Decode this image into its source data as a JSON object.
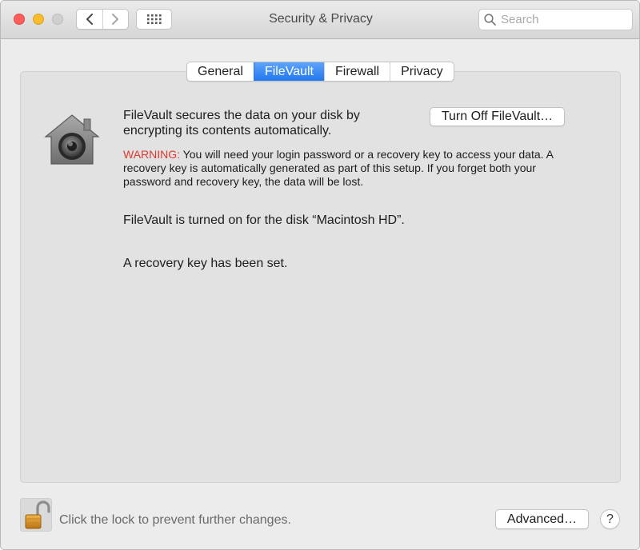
{
  "window": {
    "title": "Security & Privacy"
  },
  "toolbar": {
    "back_icon": "chevron-left-icon",
    "forward_icon": "chevron-right-icon",
    "show_all_icon": "grid-icon"
  },
  "search": {
    "placeholder": "Search",
    "value": ""
  },
  "tabs": [
    {
      "label": "General",
      "active": false
    },
    {
      "label": "FileVault",
      "active": true
    },
    {
      "label": "Firewall",
      "active": false
    },
    {
      "label": "Privacy",
      "active": false
    }
  ],
  "filevault": {
    "icon": "filevault-house-safe-icon",
    "description": "FileVault secures the data on your disk by encrypting its contents automatically.",
    "turn_off_button": "Turn Off FileVault…",
    "warning_label": "WARNING:",
    "warning_text": " You will need your login password or a recovery key to access your data. A recovery key is automatically generated as part of this setup. If you forget both your password and recovery key, the data will be lost.",
    "status_disk": "FileVault is turned on for the disk “Macintosh HD”.",
    "status_recovery": "A recovery key has been set."
  },
  "footer": {
    "lock_icon": "unlocked-padlock-icon",
    "lock_text": "Click the lock to prevent further changes.",
    "advanced_button": "Advanced…",
    "help_button": "?"
  },
  "colors": {
    "active_tab": "#2f80f0",
    "warning": "#e0382f",
    "close": "#fc5f57",
    "minimize": "#fdbc2e"
  }
}
